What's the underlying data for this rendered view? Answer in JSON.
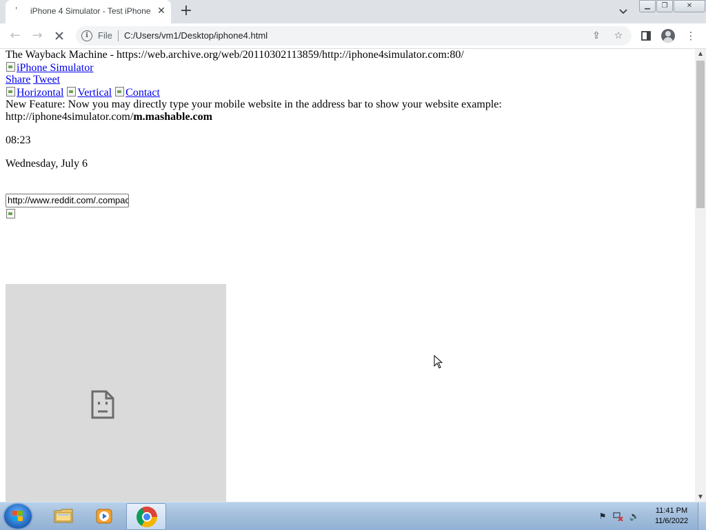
{
  "browser": {
    "tab_title": "iPhone 4 Simulator - Test iPhone",
    "tab_favicon": "'",
    "url_scheme": "File",
    "url": "C:/Users/vm1/Desktop/iphone4.html"
  },
  "page": {
    "wayback_line": "The Wayback Machine - https://web.archive.org/web/20110302113859/http://iphone4simulator.com:80/",
    "logo_alt": "iPhone Simulator",
    "share_label": "Share",
    "tweet_label": "Tweet",
    "horizontal_alt": "Horizontal",
    "vertical_alt": "Vertical",
    "contact_alt": "Contact",
    "feature_text": "New Feature: Now you may directly type your mobile website in the address bar to show your website example:",
    "example_prefix": "http://iphone4simulator.com/",
    "example_bold": "m.mashable.com",
    "time": "08:23",
    "date": "Wednesday, July 6",
    "url_input_value": "http://www.reddit.com/.compact"
  },
  "taskbar": {
    "time": "11:41 PM",
    "date": "11/6/2022"
  },
  "colors": {
    "link": "#0000ee",
    "tab_strip": "#dee1e6",
    "frame_bg": "#dadada",
    "taskbar": "#a4bfdc"
  }
}
